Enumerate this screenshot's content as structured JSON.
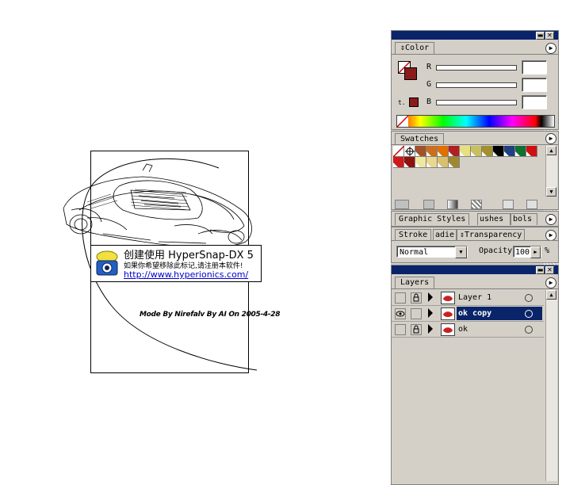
{
  "artwork": {
    "caption": "Mode By Nirefalv By AI On 2005-4-28",
    "watermark": {
      "line1": "创建使用 HyperSnap-DX 5",
      "line2": "如果你希望移除此标记,请注册本软件!",
      "link": "http://www.hyperionics.com/"
    }
  },
  "color_panel": {
    "tab": "Color",
    "channels": [
      {
        "label": "R",
        "value": ""
      },
      {
        "label": "G",
        "value": ""
      },
      {
        "label": "B",
        "value": ""
      }
    ],
    "fill_color": "#8b1a1a",
    "stroke_color": "#cc0000"
  },
  "swatches_panel": {
    "tab": "Swatches",
    "row1": [
      "#ffffff",
      "#ffffff",
      "#a0522d",
      "#c87020",
      "#e07000",
      "#b02020",
      "#e8e080",
      "#c8c060",
      "#a09030",
      "#000000",
      "#204080",
      "#107030",
      "#d01010"
    ],
    "row2": [
      "#d01818",
      "#901010",
      "#f0e8a0",
      "#e8d890",
      "#d8c070",
      "#a08830"
    ]
  },
  "styles_panel": {
    "tabs": [
      "Graphic Styles",
      "Swatches",
      "Symbols"
    ],
    "tab_texts": [
      "Graphic Styles",
      "ushes",
      "bols"
    ]
  },
  "transparency_panel": {
    "tabs": [
      "Stroke",
      "Gradient",
      "Transparency"
    ],
    "tab_texts": [
      "Stroke",
      "adie",
      "Transparency"
    ],
    "blend_mode": "Normal",
    "opacity_label": "Opacity",
    "opacity_value": "100",
    "opacity_unit": "%"
  },
  "layers_panel": {
    "tab": "Layers",
    "layers": [
      {
        "name": "Layer 1",
        "visible": false,
        "locked": true,
        "selected": false
      },
      {
        "name": "ok copy",
        "visible": true,
        "locked": false,
        "selected": true
      },
      {
        "name": "ok",
        "visible": false,
        "locked": true,
        "selected": false
      }
    ]
  },
  "colors": {
    "title_bar": "#0a246a",
    "panel_bg": "#d4d0c8"
  }
}
